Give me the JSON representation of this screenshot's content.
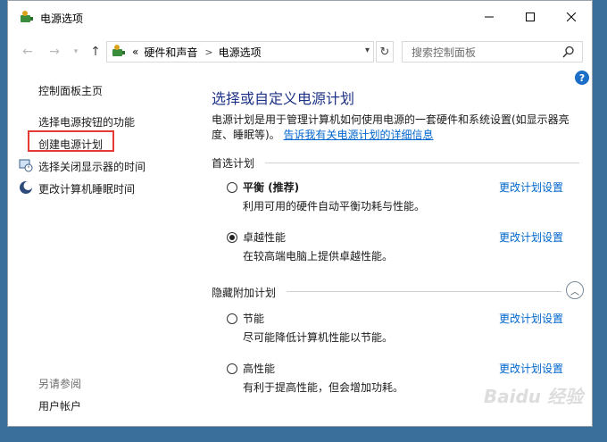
{
  "window": {
    "title": "电源选项"
  },
  "address": {
    "crumb_prefix": "«",
    "crumbs": [
      "硬件和声音",
      "电源选项"
    ],
    "separator": ">"
  },
  "search": {
    "placeholder": "搜索控制面板"
  },
  "left_nav": {
    "home": "控制面板主页",
    "items": [
      "选择电源按钮的功能",
      "创建电源计划",
      "选择关闭显示器的时间",
      "更改计算机睡眠时间"
    ],
    "see_also_title": "另请参阅",
    "see_also_items": [
      "用户帐户"
    ]
  },
  "main": {
    "heading": "选择或自定义电源计划",
    "description": "电源计划是用于管理计算机如何使用电源的一套硬件和系统设置(如显示器亮度、睡眠等)。",
    "description_link": "告诉我有关电源计划的详细信息",
    "preferred_title": "首选计划",
    "hidden_title": "隐藏附加计划",
    "change_label": "更改计划设置",
    "plans": [
      {
        "name": "平衡 (推荐)",
        "desc": "利用可用的硬件自动平衡功耗与性能。",
        "selected": false
      },
      {
        "name": "卓越性能",
        "desc": "在较高端电脑上提供卓越性能。",
        "selected": true
      },
      {
        "name": "节能",
        "desc": "尽可能降低计算机性能以节能。",
        "selected": false
      },
      {
        "name": "高性能",
        "desc": "有利于提高性能，但会增加功耗。",
        "selected": false
      }
    ]
  },
  "watermark": "Baidu 经验",
  "colors": {
    "accent": "#0066cc",
    "heading": "#1e3287",
    "highlight": "#e53935",
    "desktop": "#3a6f9c"
  }
}
